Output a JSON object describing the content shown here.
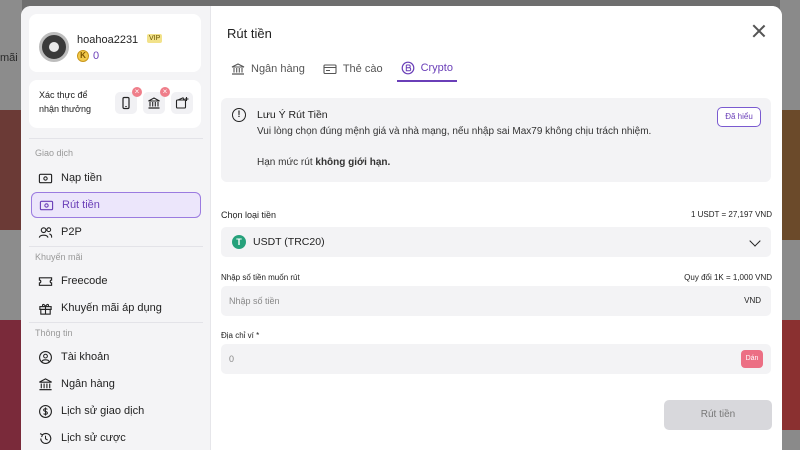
{
  "sidebar": {
    "user": {
      "name": "hoahoa2231",
      "vip": "VIP",
      "balance": "0"
    },
    "verify": {
      "label": "Xác thực để nhận thưởng"
    },
    "sections": {
      "transactions": "Giao dịch",
      "promotions": "Khuyến mãi",
      "info": "Thông tin"
    },
    "items": [
      {
        "label": "Nạp tiền"
      },
      {
        "label": "Rút tiền"
      },
      {
        "label": "P2P"
      },
      {
        "label": "Freecode"
      },
      {
        "label": "Khuyến mãi áp dụng"
      },
      {
        "label": "Tài khoản"
      },
      {
        "label": "Ngân hàng"
      },
      {
        "label": "Lịch sử giao dịch"
      },
      {
        "label": "Lịch sử cược"
      }
    ]
  },
  "main": {
    "title": "Rút tiền",
    "tabs": [
      {
        "label": "Ngân hàng"
      },
      {
        "label": "Thẻ cào"
      },
      {
        "label": "Crypto"
      }
    ],
    "notice": {
      "title": "Lưu Ý Rút Tiền",
      "body": "Vui lòng chọn đúng mệnh giá và nhà mạng, nếu nhập sai Max79 không chịu trách nhiệm.",
      "limit_prefix": "Hạn mức rút",
      "limit_bold": "không giới hạn.",
      "button": "Đã hiểu"
    },
    "currency": {
      "label": "Chọn loại tiền",
      "rate": "1 USDT = 27,197 VND",
      "value": "USDT (TRC20)"
    },
    "amount": {
      "label": "Nhập số tiền muốn rút",
      "rate": "Quy đổi 1K = 1,000 VND",
      "placeholder": "Nhập số tiền",
      "unit": "VND"
    },
    "wallet": {
      "label": "Địa chỉ ví *",
      "value": "0",
      "paste": "Dán"
    },
    "submit": "Rút tiền"
  },
  "background": {
    "left_text": "mãi"
  },
  "colors": {
    "accent": "#6a3fb8",
    "active_bg": "#ece6fb",
    "paste": "#ec6f84",
    "tether": "#26a17b"
  }
}
